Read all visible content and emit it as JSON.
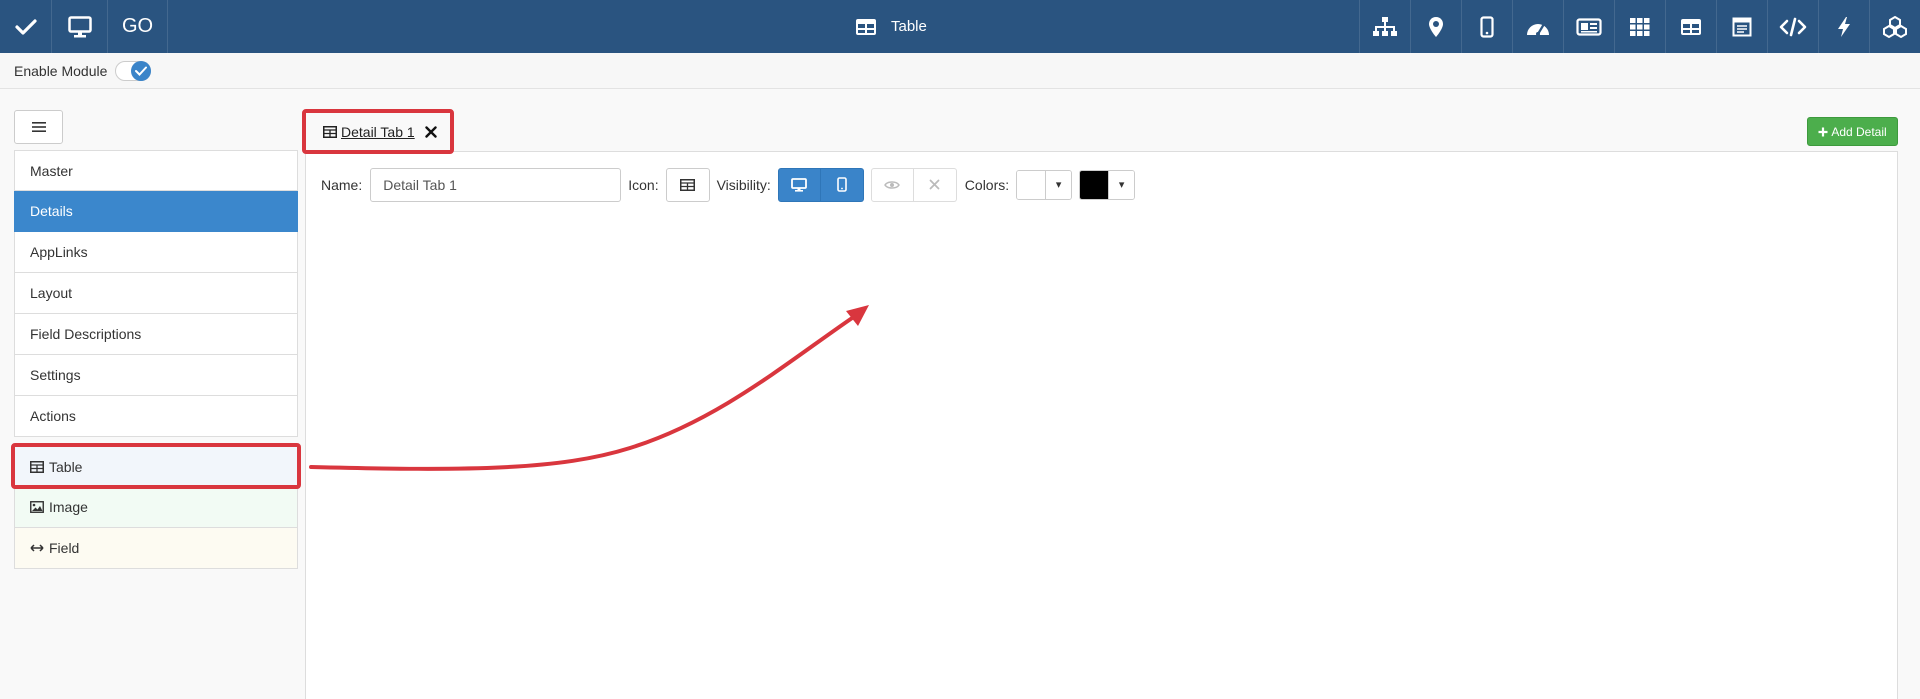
{
  "topbar": {
    "go_label": "GO",
    "title": "Table",
    "icons": [
      "sitemap-icon",
      "map-marker-icon",
      "mobile-icon",
      "dashboard-icon",
      "card-icon",
      "grid-icon",
      "table-icon",
      "calendar-list-icon",
      "code-icon",
      "bolt-icon",
      "cubes-icon"
    ]
  },
  "module": {
    "enable_label": "Enable Module",
    "enabled": true
  },
  "sidebar": {
    "items": [
      {
        "label": "Master"
      },
      {
        "label": "Details"
      },
      {
        "label": "AppLinks"
      },
      {
        "label": "Layout"
      },
      {
        "label": "Field Descriptions"
      },
      {
        "label": "Settings"
      },
      {
        "label": "Actions"
      }
    ],
    "active_index": 1,
    "widgets": [
      {
        "label": "Table",
        "icon": "table-icon"
      },
      {
        "label": "Image",
        "icon": "image-icon"
      },
      {
        "label": "Field",
        "icon": "arrows-h-icon"
      }
    ]
  },
  "tab": {
    "label": "Detail Tab 1"
  },
  "add_detail_label": "Add Detail",
  "form": {
    "name_label": "Name:",
    "name_value": "Detail Tab 1",
    "icon_label": "Icon:",
    "visibility_label": "Visibility:",
    "colors_label": "Colors:",
    "color_bg": "#ffffff",
    "color_fg": "#000000",
    "caret": "▾"
  },
  "colors": {
    "brand": "#2a5480",
    "active": "#3b87cc",
    "success": "#4cae4c",
    "annotation": "#d9363e"
  }
}
